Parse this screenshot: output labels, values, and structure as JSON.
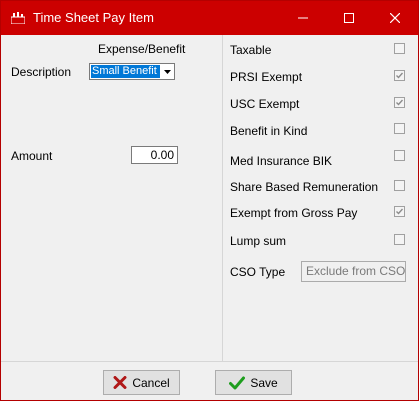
{
  "window": {
    "title": "Time Sheet Pay Item",
    "controls": [
      "minimize-icon",
      "maximize-icon",
      "close-icon"
    ],
    "title_bar_color": "#cc0000"
  },
  "left": {
    "type_header": "Expense/Benefit",
    "description_label": "Description",
    "description_value": "Small Benefit E",
    "amount_label": "Amount",
    "amount_value": "0.00"
  },
  "right": {
    "options": [
      {
        "label": "Taxable",
        "checked": false
      },
      {
        "label": "PRSI Exempt",
        "checked": true
      },
      {
        "label": "USC Exempt",
        "checked": true
      },
      {
        "label": "Benefit in Kind",
        "checked": false
      },
      {
        "label": "Med Insurance BIK",
        "checked": false
      },
      {
        "label": "Share Based Remuneration",
        "checked": false
      },
      {
        "label": "Exempt from Gross Pay",
        "checked": true
      },
      {
        "label": "Lump sum",
        "checked": false
      }
    ],
    "cso_label": "CSO Type",
    "cso_value": "Exclude from CSO"
  },
  "footer": {
    "cancel_label": "Cancel",
    "save_label": "Save"
  }
}
